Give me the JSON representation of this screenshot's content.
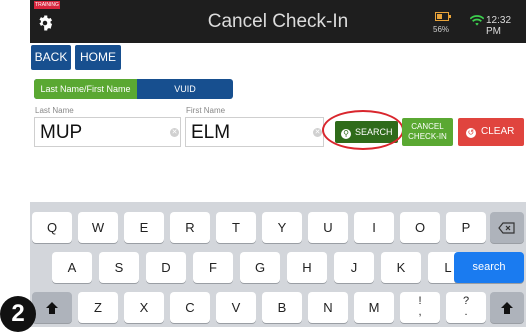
{
  "header": {
    "training_badge": "TRAINING",
    "title": "Cancel Check-In",
    "battery_percent": "56%",
    "time": "12:32 PM",
    "colors": {
      "bar": "#1e1e1e",
      "battery": "#e8a33a",
      "wifi": "#3ccf4e"
    }
  },
  "nav": {
    "back_label": "BACK",
    "home_label": "HOME"
  },
  "search_mode": {
    "tabs": [
      {
        "label": "Last Name/First Name",
        "selected": true
      },
      {
        "label": "VUID",
        "selected": false
      }
    ]
  },
  "form": {
    "last_name": {
      "label": "Last Name",
      "value": "MUP"
    },
    "first_name": {
      "label": "First Name",
      "value": "ELM"
    }
  },
  "actions": {
    "search_label": "SEARCH",
    "cancel_line1": "CANCEL",
    "cancel_line2": "CHECK-IN",
    "clear_label": "CLEAR"
  },
  "keyboard": {
    "row1": [
      "Q",
      "W",
      "E",
      "R",
      "T",
      "Y",
      "U",
      "I",
      "O",
      "P"
    ],
    "row2": [
      "A",
      "S",
      "D",
      "F",
      "G",
      "H",
      "J",
      "K",
      "L"
    ],
    "row3": [
      "Z",
      "X",
      "C",
      "V",
      "B",
      "N",
      "M"
    ],
    "punct1": [
      "!",
      ","
    ],
    "punct2": [
      "?",
      "."
    ],
    "search_label": "search"
  },
  "step_badge": "2",
  "icons": [
    "gear-icon",
    "battery-icon",
    "wifi-icon",
    "search-icon",
    "clear-icon",
    "backspace-icon",
    "shift-icon"
  ]
}
